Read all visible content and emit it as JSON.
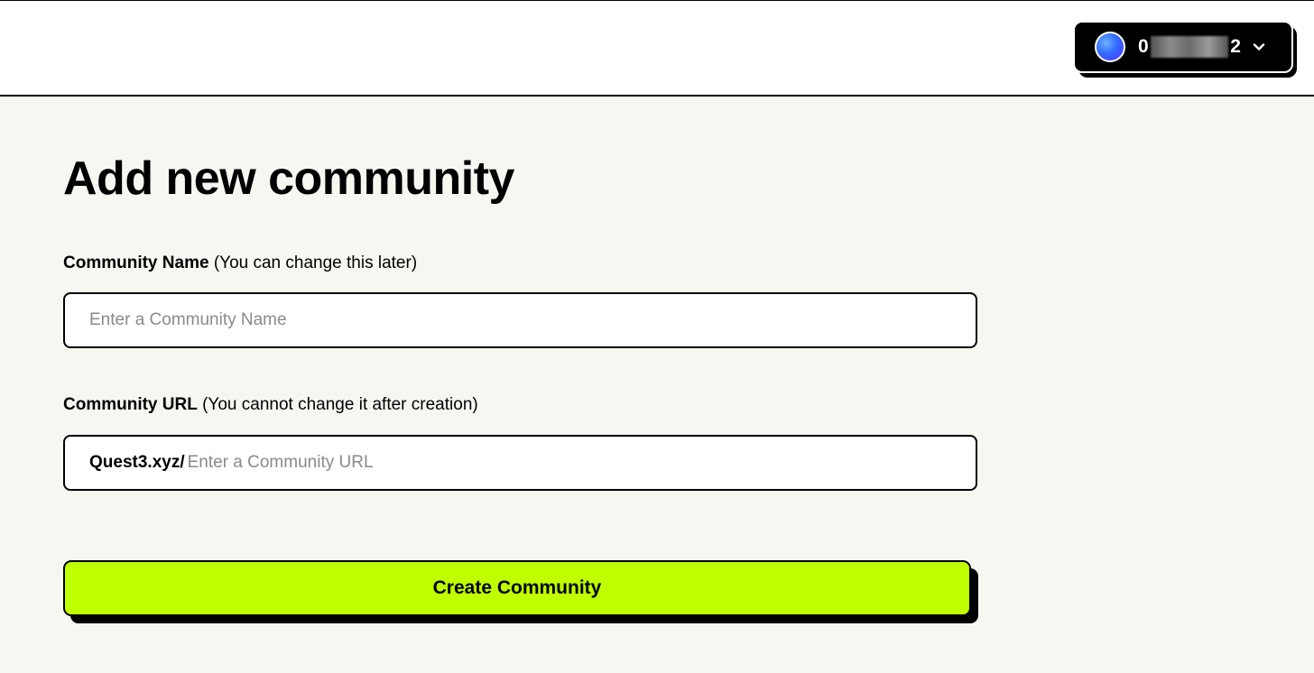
{
  "header": {
    "wallet": {
      "address_start": "0",
      "address_end": "2",
      "avatar_icon": "gradient-avatar-icon",
      "chevron_icon": "chevron-down-icon"
    }
  },
  "main": {
    "title": "Add new community",
    "community_name": {
      "label_bold": "Community Name",
      "label_note": "(You can change this later)",
      "placeholder": "Enter a Community Name",
      "value": ""
    },
    "community_url": {
      "label_bold": "Community URL",
      "label_note": "(You cannot change it after creation)",
      "prefix": "Quest3.xyz/",
      "placeholder": "Enter a Community URL",
      "value": ""
    },
    "create_button_label": "Create Community"
  },
  "colors": {
    "accent": "#c0ff00",
    "background": "#f7f7f2",
    "header_background": "#ffffff"
  }
}
